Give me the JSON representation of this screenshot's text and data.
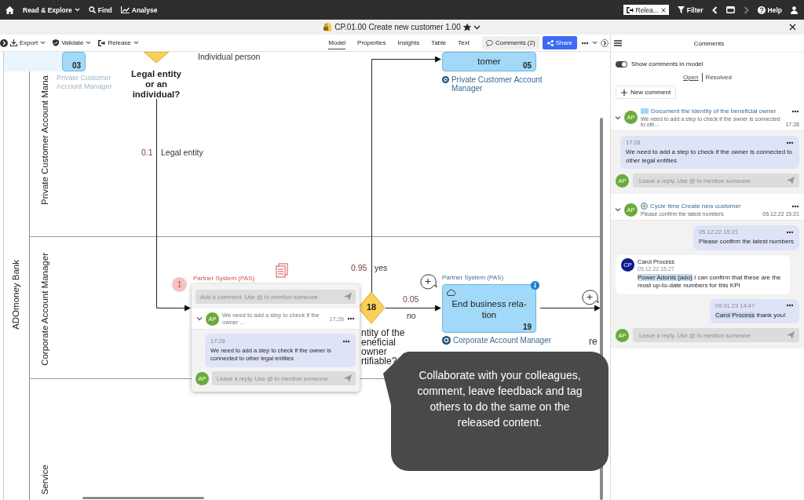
{
  "top_bar": {
    "menu_label": "Read & Explore",
    "find_label": "Find",
    "analyse_label": "Analyse",
    "chip_label": "Relea...",
    "filter_label": "Filter",
    "help_label": "Help"
  },
  "title_bar": {
    "title": "CP.01.00 Create new customer 1.00",
    "starred": true
  },
  "toolbar": {
    "actions": [
      {
        "kind": "export",
        "label": "Export"
      },
      {
        "kind": "validate",
        "label": "Validate"
      },
      {
        "kind": "release",
        "label": "Release"
      }
    ],
    "view_tabs": [
      {
        "label": "Model",
        "selected": true
      },
      {
        "label": "Properties",
        "selected": false
      },
      {
        "label": "Insights",
        "selected": false
      },
      {
        "label": "Table",
        "selected": false
      },
      {
        "label": "Text",
        "selected": false
      }
    ],
    "comments_button": "Comments (2)",
    "share_button": "Share"
  },
  "diagram": {
    "pool": "ADOmoney Bank",
    "lanes": [
      "Private Customer Account Mana",
      "Corporate Account Manager",
      "Service"
    ],
    "tasks": [
      {
        "number": "03",
        "faded": true,
        "performer": "Private Customer Account Manager"
      },
      {
        "number": "05",
        "text": "tomer",
        "performer": "Private Customer Account Manager"
      },
      {
        "number": "19",
        "text": "End business rela-\ntion",
        "system": "Partner System (PAS)",
        "performer": "Corporate Account Manager"
      }
    ],
    "gateways": [
      {
        "question": "Legal entity\nor an\nindividual?"
      },
      {
        "number": "18",
        "question": "ntity of the\neneficial\nowner\nrtifiable?"
      }
    ],
    "flow_labels": [
      {
        "kind": "condition",
        "text": "Individual person"
      },
      {
        "kind": "probability",
        "text": "0.1"
      },
      {
        "kind": "condition",
        "text": "Legal entity"
      },
      {
        "kind": "probability",
        "text": "0.95"
      },
      {
        "kind": "condition",
        "text": "yes"
      },
      {
        "kind": "probability",
        "text": "0.05"
      },
      {
        "kind": "condition",
        "text": "no"
      },
      {
        "kind": "condition",
        "text": "re"
      }
    ],
    "annotation": {
      "badge": "1",
      "system": "Partner System (PAS)"
    },
    "popup": {
      "comment_placeholder": "Add a comment. Use @ to mention someone.",
      "initials": "AP",
      "preview": "We need to add a step to check if the owner ...",
      "time": "17:28",
      "expanded": true,
      "message_time": "17:28",
      "message": "We need to add a step to check if the owner is connected to other legal entities",
      "reply_initials": "AP",
      "reply_placeholder": "Leave a reply. Use @ to mention someone"
    },
    "callout": "Collaborate with your colleagues, comment, leave feedback and tag others to do the same on the released content."
  },
  "comments_panel": {
    "title": "Comments",
    "show_in_model": {
      "label": "Show comments in model",
      "on": true
    },
    "tabs": [
      {
        "label": "Open",
        "selected": true
      },
      {
        "label": "Resolved",
        "selected": false
      }
    ],
    "new_comment": "New comment",
    "threads": [
      {
        "initials": "AP",
        "kind": "task",
        "title": "Document the identity of the beneficial owner",
        "preview": "We need to add a step to check if the owner is connected to oth...",
        "time": "17:28",
        "expanded": true,
        "messages": [
          {
            "own": true,
            "time": "17:28",
            "text": "We need to add a step to check if the owner is connected to other legal entities"
          }
        ],
        "reply_initials": "AP",
        "reply_placeholder": "Leave a reply. Use @ to mention someone."
      },
      {
        "initials": "AP",
        "kind": "kpi",
        "title": "Cycle time Create new customer",
        "preview": "Please confirm the latest numbers",
        "time": "05.12.22 15:21",
        "expanded": true,
        "messages": [
          {
            "own": true,
            "time": "05.12.22 15:21",
            "text": "Please confirm the latest numbers"
          },
          {
            "own": false,
            "initials": "CP",
            "author": "Carol Process",
            "time": "05.12.22 15:27",
            "mention": "Power Adonis (ado)",
            "text": "I can confirm that these are the most up-to-date numbers for this KPI"
          },
          {
            "own": true,
            "time": "09.01.23 14:47",
            "mention": "Carol Process",
            "text": "thank you!"
          }
        ],
        "reply_initials": "AP",
        "reply_placeholder": "Leave a reply. Use @ to mention someone."
      }
    ]
  }
}
